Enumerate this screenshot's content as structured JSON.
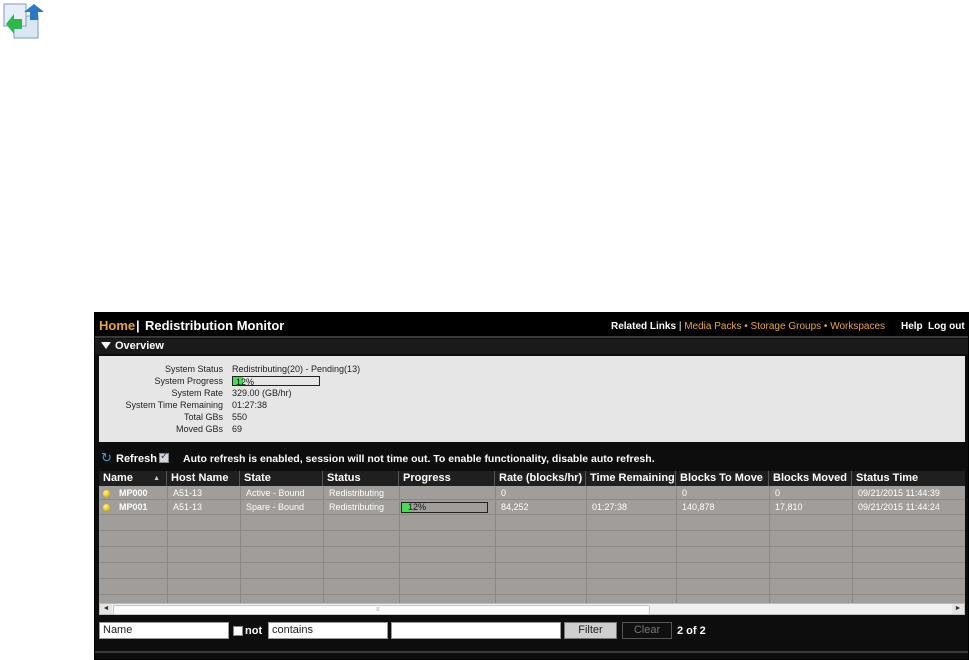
{
  "app_icon": "redistribution-app-icon",
  "header": {
    "home": "Home",
    "separator": "|",
    "title": "Redistribution Monitor",
    "related_links_label": "Related Links",
    "links_separator": "|",
    "links": [
      "Media Packs",
      "Storage Groups",
      "Workspaces"
    ],
    "link_dot": "•",
    "help": "Help",
    "logout": "Log out"
  },
  "overview": {
    "title": "Overview",
    "rows": [
      {
        "key": "System Status",
        "value": "Redistributing(20) - Pending(13)"
      },
      {
        "key": "System Progress",
        "value": "12%",
        "progress": 0.12
      },
      {
        "key": "System Rate",
        "value": "329.00 (GB/hr)"
      },
      {
        "key": "System Time Remaining",
        "value": "01:27:38"
      },
      {
        "key": "Total GBs",
        "value": "550"
      },
      {
        "key": "Moved GBs",
        "value": "69"
      }
    ]
  },
  "refresh": {
    "label": "Refresh",
    "checked": true,
    "message": "Auto refresh is enabled, session will not time out. To enable functionality, disable auto refresh."
  },
  "table": {
    "columns": [
      "Name",
      "Host Name",
      "State",
      "Status",
      "Progress",
      "Rate (blocks/hr)",
      "Time Remaining",
      "Blocks To Move",
      "Blocks Moved",
      "Status Time"
    ],
    "sort_indicator": "▲",
    "rows": [
      {
        "name": "MP000",
        "host": "A51-13",
        "state": "Active - Bound",
        "status": "Redistributing",
        "progress_text": "",
        "progress": 0,
        "rate": "0",
        "time_remaining": "",
        "blocks_to_move": "0",
        "blocks_moved": "0",
        "status_time": "09/21/2015 11:44:39",
        "status_color": "#f2c700"
      },
      {
        "name": "MP001",
        "host": "A51-13",
        "state": "Spare - Bound",
        "status": "Redistributing",
        "progress_text": "12%",
        "progress": 0.12,
        "rate": "84,252",
        "time_remaining": "01:27:38",
        "blocks_to_move": "140,878",
        "blocks_moved": "17,810",
        "status_time": "09/21/2015 11:44:24",
        "status_color": "#f2c700"
      }
    ]
  },
  "scrollbar": {
    "left_arrow": "◄",
    "right_arrow": "►",
    "grip": "≡"
  },
  "filter": {
    "field": "Name",
    "not_label": "not",
    "operator": "contains",
    "value": "",
    "filter_button": "Filter",
    "clear_button": "Clear",
    "count": "2 of 2"
  },
  "colors": {
    "accent": "#e8a53a",
    "progress": "#44dd55",
    "status_dot": "#f2c700"
  }
}
